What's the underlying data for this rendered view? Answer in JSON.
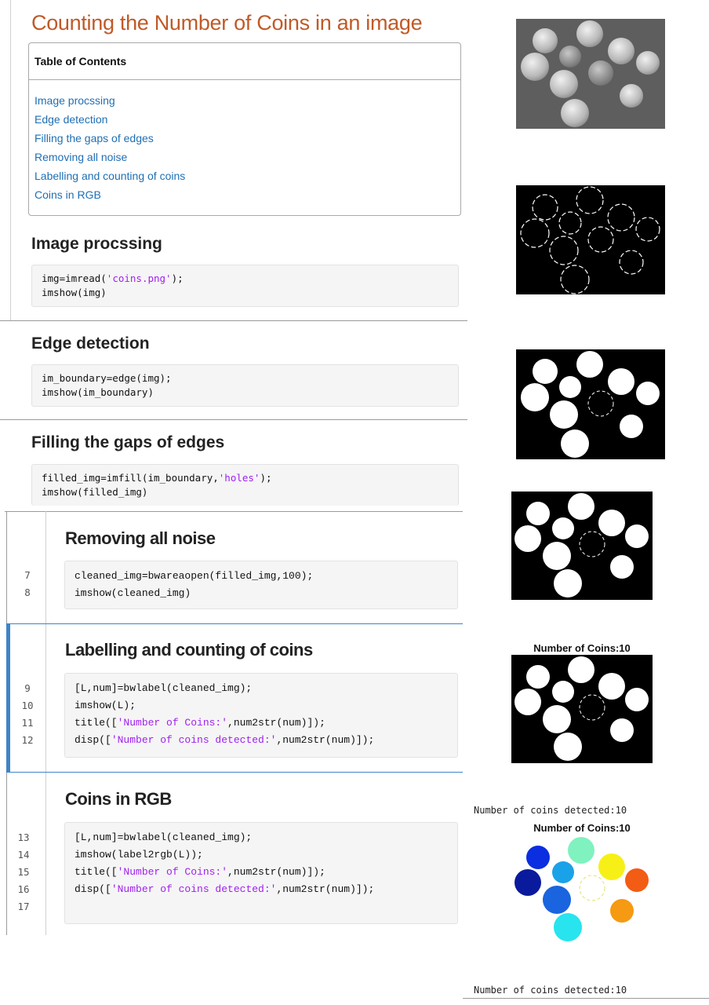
{
  "doc_title": "Counting the Number of Coins in an image",
  "toc": {
    "heading": "Table of Contents",
    "items": [
      "Image procssing",
      "Edge detection",
      "Filling the gaps of edges",
      "Removing all noise",
      "Labelling and counting of coins",
      "Coins in RGB"
    ]
  },
  "sections": {
    "s1": {
      "title": "Image procssing",
      "code": [
        "img=imread('coins.png');",
        "imshow(img)"
      ]
    },
    "s2": {
      "title": "Edge detection",
      "code": [
        "im_boundary=edge(img);",
        "imshow(im_boundary)"
      ]
    },
    "s3": {
      "title": "Filling the gaps of edges",
      "code": [
        "filled_img=imfill(im_boundary,'holes');",
        "imshow(filled_img)"
      ]
    },
    "s4": {
      "title": "Removing all noise",
      "line_numbers": [
        "7",
        "8"
      ],
      "code": [
        "cleaned_img=bwareaopen(filled_img,100);",
        "imshow(cleaned_img)"
      ]
    },
    "s5": {
      "title": "Labelling and counting of coins",
      "line_numbers": [
        "9",
        "10",
        "11",
        "12"
      ],
      "code": [
        "[L,num]=bwlabel(cleaned_img);",
        "imshow(L);",
        "title(['Number of Coins:',num2str(num)]);",
        "disp(['Number of coins detected:',num2str(num)]);"
      ]
    },
    "s6": {
      "title": "Coins in RGB",
      "line_numbers": [
        "13",
        "14",
        "15",
        "16",
        "17"
      ],
      "code": [
        "[L,num]=bwlabel(cleaned_img);",
        "imshow(label2rgb(L));",
        "title(['Number of Coins:',num2str(num)]);",
        "disp(['Number of coins detected:',num2str(num)]);",
        ""
      ]
    }
  },
  "outputs": {
    "fig5_title": "Number of Coins:10",
    "disp1": "Number of coins detected:10",
    "fig6_title": "Number of Coins:10",
    "disp2": "Number of coins detected:10"
  },
  "colors": {
    "title": "#c05a28",
    "link": "#1f6fb4",
    "string": "#a020f0",
    "active_bar": "#3d85c6"
  }
}
